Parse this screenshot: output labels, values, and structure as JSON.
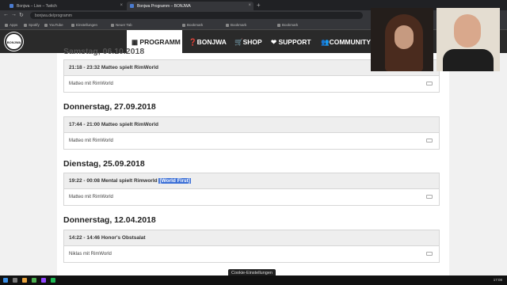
{
  "browser": {
    "tabs": [
      {
        "label": "Bonjwa – Live – Twitch"
      },
      {
        "label": "Bonjwa Programm – BONJWA"
      }
    ],
    "url": "bonjwa.de/programm",
    "bookmarks": [
      "Apps",
      "Spotify",
      "YouTube",
      "Einstellungen",
      "Neuer Tab",
      "Bookmark",
      "Bookmark",
      "Bookmark"
    ]
  },
  "site": {
    "logo_text": "BONJWA",
    "menu": {
      "programm": "PROGRAMM",
      "bonjwa": "BONJWA",
      "shop": "SHOP",
      "support": "SUPPORT",
      "community": "COMMUNITY"
    },
    "partial_day": "Samstag, 06.10.2018",
    "schedule": [
      {
        "day": "",
        "time": "21:18 - 23:32 Matteo spielt RimWorld",
        "highlight": "",
        "desc": "Matteo mit RimWorld"
      },
      {
        "day": "Donnerstag, 27.09.2018",
        "time": "17:44 - 21:00 Matteo spielt RimWorld",
        "highlight": "",
        "desc": "Matteo mit RimWorld"
      },
      {
        "day": "Dienstag, 25.09.2018",
        "time": "19:22 - 00:08 Mental spielt Rimworld",
        "highlight": "[World First]",
        "desc": "Matteo mit RimWorld"
      },
      {
        "day": "Donnerstag, 12.04.2018",
        "time": "14:22 - 14:46 Honor's Obstsalat",
        "highlight": "",
        "desc": "Niklas mit RimWorld"
      }
    ],
    "cookie": "Cookie-Einstellungen"
  },
  "taskbar": {
    "clock": "17:08"
  },
  "icons": [
    "calendar-icon",
    "question-icon",
    "cart-icon",
    "heart-icon",
    "users-icon",
    "comment-icon"
  ]
}
